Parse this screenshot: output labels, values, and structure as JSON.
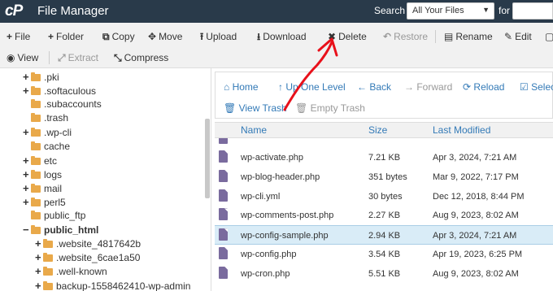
{
  "header": {
    "app_title": "File Manager",
    "search_label": "Search",
    "search_scope": "All Your Files",
    "for_label": "for"
  },
  "toolbar": {
    "file": "File",
    "folder": "Folder",
    "copy": "Copy",
    "move": "Move",
    "upload": "Upload",
    "download": "Download",
    "delete": "Delete",
    "restore": "Restore",
    "rename": "Rename",
    "edit": "Edit",
    "view": "View",
    "extract": "Extract",
    "compress": "Compress"
  },
  "sidebar": {
    "items": [
      {
        "label": ".pki",
        "expander": "+"
      },
      {
        "label": ".softaculous",
        "expander": "+"
      },
      {
        "label": ".subaccounts",
        "expander": ""
      },
      {
        "label": ".trash",
        "expander": ""
      },
      {
        "label": ".wp-cli",
        "expander": "+"
      },
      {
        "label": "cache",
        "expander": ""
      },
      {
        "label": "etc",
        "expander": "+"
      },
      {
        "label": "logs",
        "expander": "+"
      },
      {
        "label": "mail",
        "expander": "+"
      },
      {
        "label": "perl5",
        "expander": "+"
      },
      {
        "label": "public_ftp",
        "expander": ""
      },
      {
        "label": "public_html",
        "expander": "−"
      },
      {
        "label": ".website_4817642b",
        "expander": "+"
      },
      {
        "label": ".website_6cae1a50",
        "expander": "+"
      },
      {
        "label": ".well-known",
        "expander": "+"
      },
      {
        "label": "backup-1558462410-wp-admin",
        "expander": "+"
      }
    ]
  },
  "nav": {
    "home": "Home",
    "up_one_level": "Up One Level",
    "back": "Back",
    "forward": "Forward",
    "reload": "Reload",
    "select": "Select",
    "view_trash": "View Trash",
    "empty_trash": "Empty Trash"
  },
  "file_list": {
    "columns": {
      "name": "Name",
      "size": "Size",
      "modified": "Last Modified"
    },
    "rows": [
      {
        "name": "wp-activate.php",
        "size": "7.21 KB",
        "modified": "Apr 3, 2024, 7:21 AM"
      },
      {
        "name": "wp-blog-header.php",
        "size": "351 bytes",
        "modified": "Mar 9, 2022, 7:17 PM"
      },
      {
        "name": "wp-cli.yml",
        "size": "30 bytes",
        "modified": "Dec 12, 2018, 8:44 PM"
      },
      {
        "name": "wp-comments-post.php",
        "size": "2.27 KB",
        "modified": "Aug 9, 2023, 8:02 AM"
      },
      {
        "name": "wp-config-sample.php",
        "size": "2.94 KB",
        "modified": "Apr 3, 2024, 7:21 AM"
      },
      {
        "name": "wp-config.php",
        "size": "3.54 KB",
        "modified": "Apr 19, 2023, 6:25 PM"
      },
      {
        "name": "wp-cron.php",
        "size": "5.51 KB",
        "modified": "Aug 9, 2023, 8:02 AM"
      }
    ]
  },
  "colors": {
    "header_bg": "#293a4a",
    "link": "#337ab7",
    "selected_row": "#d9ecf7",
    "annotation_arrow": "#e8101a"
  }
}
